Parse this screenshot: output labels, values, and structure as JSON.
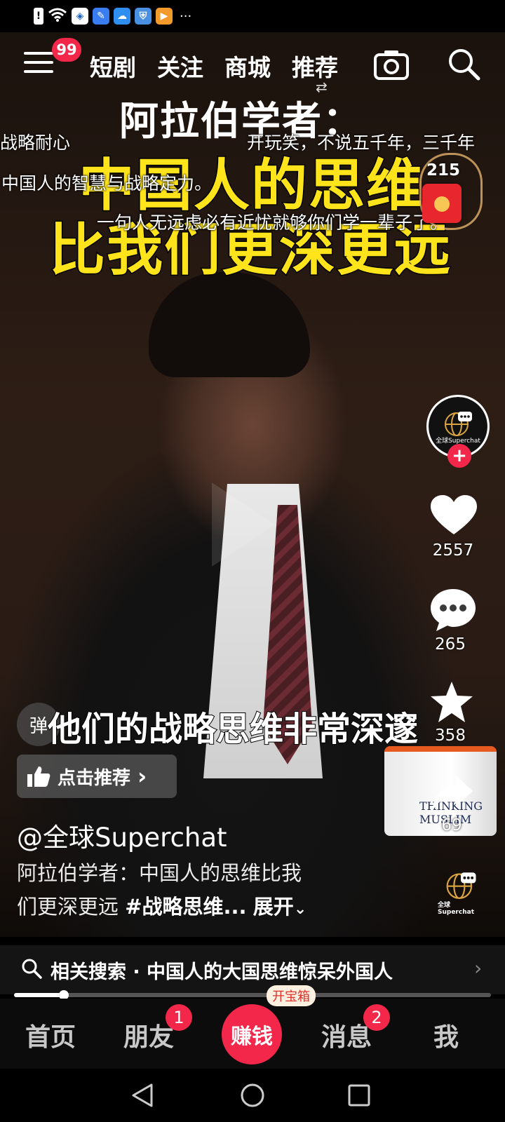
{
  "status_bar": {
    "more": "···"
  },
  "nav": {
    "badge": "99",
    "tabs": [
      "短剧",
      "关注",
      "商城",
      "推荐"
    ]
  },
  "video": {
    "title_line1": "阿拉伯学者：",
    "title_line2": "中国人的思维",
    "title_line3": "比我们更深更远",
    "subtitle": "他们的战略思维非常深邃",
    "mug_text": "THINKING MUSLIM"
  },
  "danmaku": [
    "战略耐心",
    "开玩笑，不说五千年，三千年",
    "中国人的智慧与战略定力。",
    "一句人无远虑必有近忧就够你们学一辈子了。"
  ],
  "red_packet": {
    "count": "215"
  },
  "actions": {
    "likes": "2557",
    "comments": "265",
    "favorites": "358",
    "shares": "69"
  },
  "avatar": {
    "caption": "全球Superchat"
  },
  "danmu_toggle": "弹",
  "recommend": {
    "label": "点击推荐",
    "chevron": "›"
  },
  "author": "@全球Superchat",
  "description": {
    "line1": "阿拉伯学者：中国人的思维比我",
    "line2_plain": "们更深更远 ",
    "line2_hashtag": "#战略思维...",
    "expand": "展开"
  },
  "related_search": {
    "text": "相关搜索 · 中国人的大国思维惊呆外国人",
    "arrow": "›"
  },
  "progress": {
    "fraction": 0.105
  },
  "tabbar": {
    "home": "首页",
    "friends": "朋友",
    "friends_badge": "1",
    "earn": "赚钱",
    "earn_tag": "开宝箱",
    "messages": "消息",
    "messages_badge": "2",
    "me": "我"
  },
  "colors": {
    "accent": "#f2274a",
    "title_yellow": "#ffe41b"
  }
}
